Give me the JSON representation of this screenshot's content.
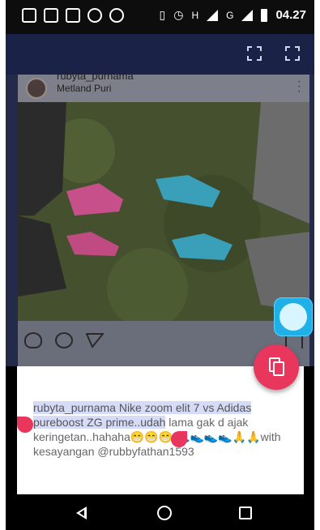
{
  "status_bar": {
    "left_icons": [
      "image-icon",
      "message-icon",
      "gallery-icon",
      "alarm-icon",
      "record-icon"
    ],
    "right_icons": [
      "vibrate-icon",
      "alarm-icon",
      "signal-h-icon",
      "signal-g-icon",
      "battery-icon"
    ],
    "signal_h": "H",
    "signal_g": "G",
    "time": "04.27"
  },
  "post": {
    "username": "rubyta_purnama",
    "location": "Metland Puri"
  },
  "caption": {
    "selected_part": "rubyta_purnama Nike zoom elit 7 vs Adidas pureboost ZG prime..udah",
    "rest_part": " lama gak d ajak keringetan..hahaha😁😁😁 👟👟👟👟🙏🙏with kesayangan @rubbyfathan1593"
  },
  "colors": {
    "accent": "#e8365d",
    "app_bar": "#1a2347",
    "selection": "#d6dbf7"
  }
}
